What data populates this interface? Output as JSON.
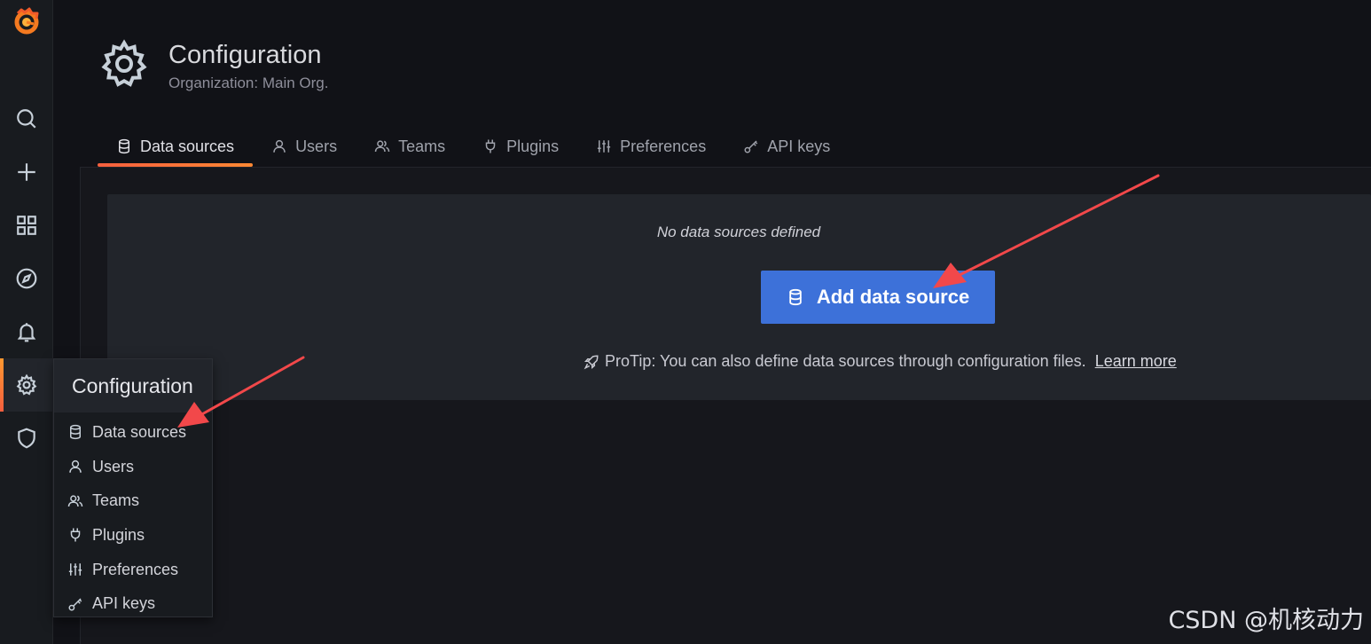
{
  "sidebar": {
    "items": [
      {
        "name": "search",
        "icon": "search-icon"
      },
      {
        "name": "create",
        "icon": "plus-icon"
      },
      {
        "name": "dashboards",
        "icon": "apps-icon"
      },
      {
        "name": "explore",
        "icon": "compass-icon"
      },
      {
        "name": "alerting",
        "icon": "bell-icon"
      },
      {
        "name": "configuration",
        "icon": "gear-icon",
        "active": true
      },
      {
        "name": "server-admin",
        "icon": "shield-icon"
      }
    ]
  },
  "header": {
    "title": "Configuration",
    "subtitle": "Organization: Main Org."
  },
  "tabs": [
    {
      "label": "Data sources",
      "icon": "database-icon",
      "active": true
    },
    {
      "label": "Users",
      "icon": "user-icon"
    },
    {
      "label": "Teams",
      "icon": "users-icon"
    },
    {
      "label": "Plugins",
      "icon": "plug-icon"
    },
    {
      "label": "Preferences",
      "icon": "sliders-icon"
    },
    {
      "label": "API keys",
      "icon": "key-icon"
    }
  ],
  "empty_state": {
    "message": "No data sources defined",
    "button_label": "Add data source",
    "protip": "ProTip: You can also define data sources through configuration files.",
    "learn_more": "Learn more"
  },
  "flyout": {
    "title": "Configuration",
    "items": [
      {
        "label": "Data sources",
        "icon": "database-icon"
      },
      {
        "label": "Users",
        "icon": "user-icon"
      },
      {
        "label": "Teams",
        "icon": "users-icon"
      },
      {
        "label": "Plugins",
        "icon": "plug-icon"
      },
      {
        "label": "Preferences",
        "icon": "sliders-icon"
      },
      {
        "label": "API keys",
        "icon": "key-icon"
      }
    ]
  },
  "watermark": "CSDN @机核动力",
  "colors": {
    "accent": "#f55f3e",
    "primary_button": "#3d71d9",
    "annotation_arrow": "#f2484a"
  }
}
